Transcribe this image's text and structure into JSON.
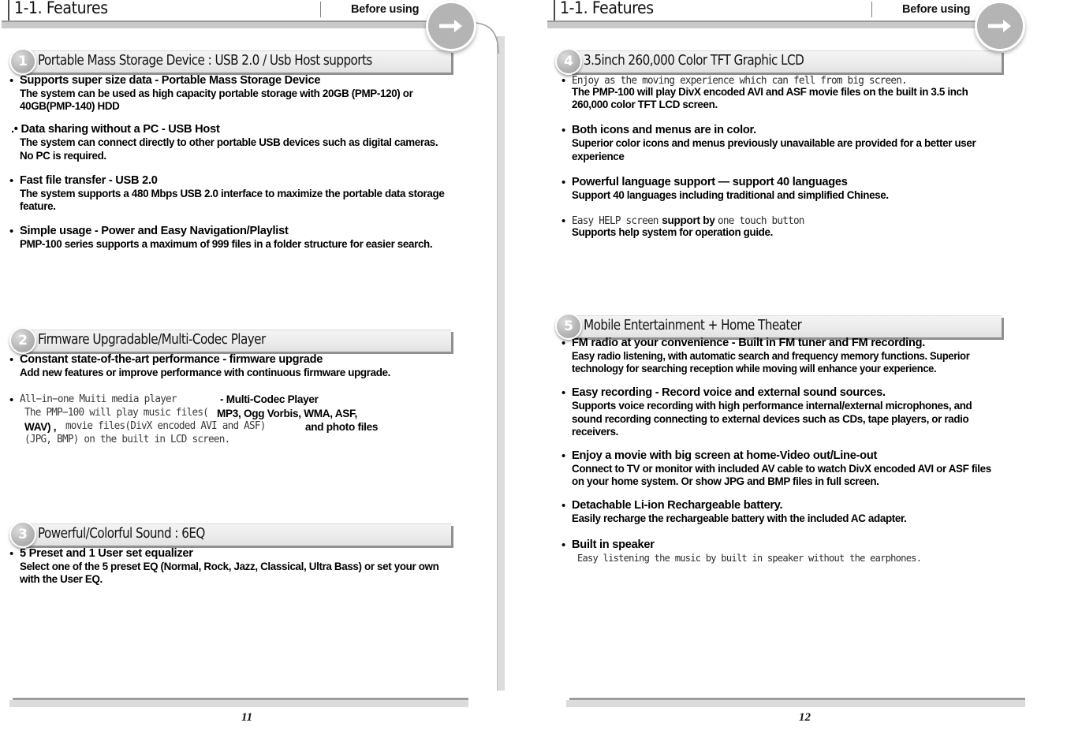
{
  "header": {
    "title": "1-1. Features",
    "subtitle": "Before using",
    "arrow_icon": "arrow-right-icon"
  },
  "left_page": {
    "page_number": "11",
    "sections": [
      {
        "number": "1",
        "title": "Portable Mass Storage Device : USB 2.0 / Usb Host supports",
        "bullets": [
          {
            "head": "Supports super size data - Portable Mass Storage Device",
            "body": "The system can be used as high capacity portable storage with 20GB (PMP-120) or 40GB(PMP-140) HDD"
          },
          {
            "head": ".• Data sharing without a PC - USB Host",
            "body": "The system can connect directly to other portable USB devices such as digital cameras. No PC is required."
          },
          {
            "head": "Fast file transfer - USB 2.0",
            "body": "The system supports a 480 Mbps USB 2.0 interface to maximize the portable data storage feature."
          },
          {
            "head": "Simple usage - Power and Easy Navigation/Playlist",
            "body": "PMP-100 series supports a maximum of 999 files in a folder structure for easier search."
          }
        ]
      },
      {
        "number": "2",
        "title": "Firmware Upgradable/Multi-Codec Player",
        "bullets": [
          {
            "head": "Constant state-of-the-art performance - firmware upgrade",
            "body": "Add new features or improve performance with continuous firmware upgrade."
          }
        ],
        "overlap_block": {
          "thin_line_1": "All−in−one Muiti media player",
          "bold_suffix_1": "- Multi-Codec Player",
          "thin_line_2": "The PMP−100 will play music files(",
          "bold_line_2": "MP3, Ogg Vorbis, WMA, ASF,",
          "bold_line_3": "WAV) ,",
          "thin_line_3": "movie files(DivX encoded AVI and ASF)",
          "bold_suffix_3": "and  photo files",
          "thin_line_4": "(JPG, BMP) on the built in LCD screen."
        }
      },
      {
        "number": "3",
        "title": "Powerful/Colorful Sound : 6EQ",
        "bullets": [
          {
            "head": " 5 Preset and 1 User set equalizer",
            "body": "Select one of the 5 preset EQ (Normal, Rock, Jazz, Classical, Ultra Bass) or set your own with the User EQ."
          }
        ]
      }
    ]
  },
  "right_page": {
    "page_number": "12",
    "sections": [
      {
        "number": "4",
        "title": "3.5inch 260,000 Color TFT Graphic LCD",
        "bullets": [
          {
            "head_thin": "Enjoy as the moving experience which can fell from big screen.",
            "body": "The PMP-100 will play DivX encoded AVI and ASF movie files on the built in 3.5 inch  260,000 color TFT LCD screen."
          },
          {
            "head": "Both icons and menus are in color.",
            "body": "Superior color icons and menus previously unavailable are provided for a better user experience"
          },
          {
            "head": "Powerful language support — support 40 languages",
            "body": "Support 40 languages including traditional and simplified Chinese."
          },
          {
            "head_mixed_thin_1": "Easy HELP screen",
            "head_mixed_bold": "support by",
            "head_mixed_thin_2": "one touch button",
            "body": "Supports help system for operation guide."
          }
        ]
      },
      {
        "number": "5",
        "title": "Mobile Entertainment + Home Theater",
        "bullets": [
          {
            "head": "FM radio at your convenience - Built in FM tuner and FM recording.",
            "body": "Easy radio listening, with automatic search and frequency memory functions. Superior technology for searching reception while moving will enhance your experience."
          },
          {
            "head": "Easy recording - Record voice and external sound sources.",
            "body": "Supports voice recording with high performance internal/external microphones, and sound recording connecting to external devices such as CDs, tape players, or radio receivers."
          },
          {
            "head": "Enjoy a movie with big screen at home-Video out/Line-out",
            "body": "Connect to TV or monitor with included AV cable to watch DivX encoded AVI or ASF files on your home system. Or show JPG and BMP files in full screen."
          },
          {
            "head": "Detachable Li-ion Rechargeable battery.",
            "body": "Easily recharge the rechargeable battery with the included AC adapter."
          },
          {
            "head": "Built in  speaker",
            "body_thin": "Easy listening the music by built in speaker without the earphones."
          }
        ]
      }
    ]
  },
  "colors": {
    "band_gray": "#ececec",
    "shadow_gray": "#909090",
    "badge_gray": "#b4b4b4",
    "rule_gray": "#c9c9c9"
  }
}
